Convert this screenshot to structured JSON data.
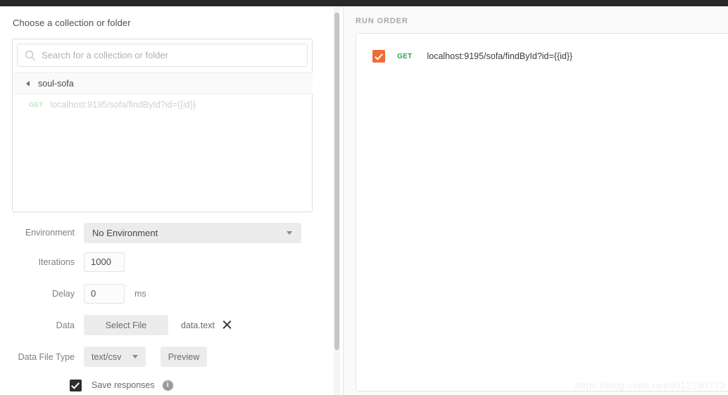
{
  "window": {
    "chrome_bar_color": "#282828"
  },
  "left_panel": {
    "section_title": "Choose a collection or folder",
    "search": {
      "placeholder": "Search for a collection or folder",
      "value": "",
      "icon": "search-icon"
    },
    "folder": {
      "name": "soul-sofa",
      "caret_icon": "caret-left-icon",
      "expanded": true
    },
    "requests": [
      {
        "method": "GET",
        "url": "localhost:9195/sofa/findById?id={{id}}",
        "muted": true
      }
    ],
    "form": {
      "environment": {
        "label": "Environment",
        "value": "No Environment",
        "caret_icon": "chevron-down-icon"
      },
      "iterations": {
        "label": "Iterations",
        "value": "1000"
      },
      "delay": {
        "label": "Delay",
        "value": "0",
        "unit": "ms"
      },
      "data": {
        "label": "Data",
        "button_label": "Select File",
        "file_name": "data.text",
        "clear_icon": "close-icon"
      },
      "data_file_type": {
        "label": "Data File Type",
        "value": "text/csv",
        "caret_icon": "chevron-down-icon",
        "preview_label": "Preview"
      },
      "save_responses": {
        "label": "Save responses",
        "checked": true,
        "info_icon": "info-icon",
        "info_glyph": "i"
      }
    }
  },
  "scrollbar": {
    "name": "left-pane-scrollbar"
  },
  "right_panel": {
    "title": "RUN ORDER",
    "items": [
      {
        "checked": true,
        "method": "GET",
        "url": "localhost:9195/sofa/findById?id={{id}}"
      }
    ]
  },
  "watermark": {
    "text": "https://blog.csdn.net/u012180773"
  },
  "colors": {
    "accent_orange": "#ef6c34",
    "method_get_green": "#27a84a",
    "method_get_muted": "#bfe3c6",
    "chrome_dark": "#282828",
    "panel_bg": "#fafafa",
    "control_gray": "#ececec"
  }
}
